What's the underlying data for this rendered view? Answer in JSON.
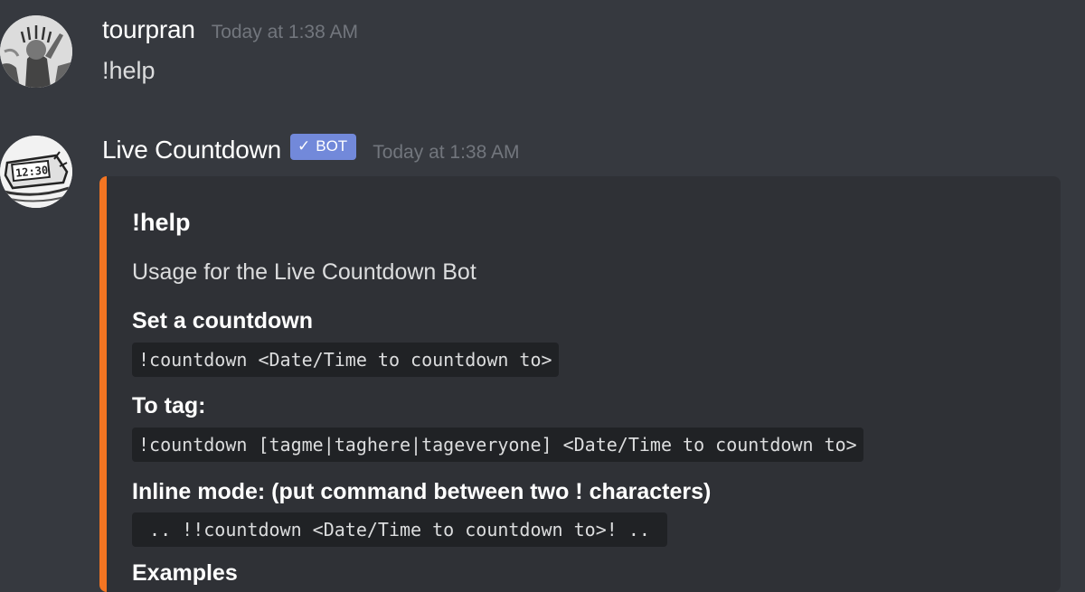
{
  "messages": [
    {
      "username": "tourpran",
      "timestamp": "Today at 1:38 AM",
      "content": "!help",
      "avatar_icon": "statue-of-liberty-avatar"
    },
    {
      "username": "Live Countdown",
      "bot_tag": "BOT",
      "bot_check": "✓",
      "timestamp": "Today at 1:38 AM",
      "avatar_icon": "alarm-clock-avatar",
      "embed": {
        "accent_color": "#f47522",
        "title": "!help",
        "description": "Usage for the Live Countdown Bot",
        "fields": [
          {
            "name": "Set a countdown",
            "value": "!countdown <Date/Time to countdown to>"
          },
          {
            "name": "To tag:",
            "value": "!countdown [tagme|taghere|tageveryone] <Date/Time to countdown to>"
          },
          {
            "name": "Inline mode: (put command between two ! characters)",
            "value": " .. !!countdown <Date/Time to countdown to>! .. "
          },
          {
            "name": "Examples",
            "value": ""
          }
        ]
      }
    }
  ],
  "colors": {
    "background": "#36393f",
    "embed_background": "#2f3136",
    "bot_tag": "#7289da",
    "timestamp": "#72767d"
  }
}
